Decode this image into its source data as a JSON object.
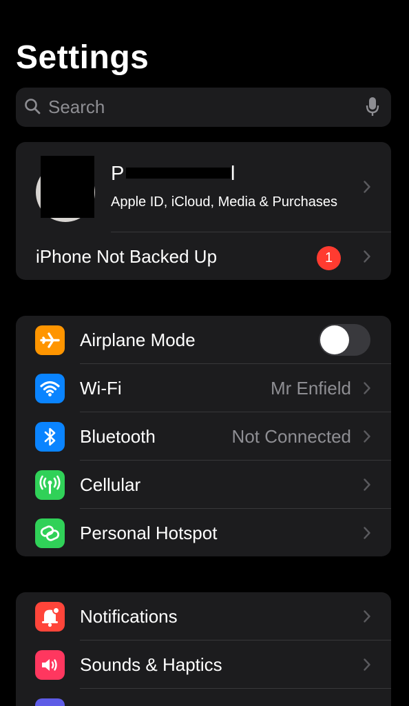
{
  "header": {
    "title": "Settings"
  },
  "search": {
    "placeholder": "Search"
  },
  "profile": {
    "name_prefix": "P",
    "name_suffix": "l",
    "subtitle": "Apple ID, iCloud, Media & Purchases",
    "backup_label": "iPhone Not Backed Up",
    "backup_badge": "1"
  },
  "connectivity": {
    "airplane": {
      "label": "Airplane Mode",
      "toggle_on": false,
      "icon": "airplane-icon",
      "color": "#ff9500"
    },
    "wifi": {
      "label": "Wi-Fi",
      "value": "Mr Enfield",
      "icon": "wifi-icon",
      "color": "#0a84ff"
    },
    "bluetooth": {
      "label": "Bluetooth",
      "value": "Not Connected",
      "icon": "bluetooth-icon",
      "color": "#0a84ff"
    },
    "cellular": {
      "label": "Cellular",
      "icon": "cellular-antenna-icon",
      "color": "#30d158"
    },
    "hotspot": {
      "label": "Personal Hotspot",
      "icon": "hotspot-link-icon",
      "color": "#30d158"
    }
  },
  "notifications_group": {
    "notifications": {
      "label": "Notifications",
      "icon": "notification-bell-icon",
      "color": "#ff453a"
    },
    "sounds": {
      "label": "Sounds & Haptics",
      "icon": "speaker-icon",
      "color": "#ff375f"
    }
  },
  "colors": {
    "background": "#000000",
    "cell": "#1c1c1e",
    "secondary_text": "#8e8e93",
    "separator": "#38383a",
    "badge": "#ff3b30",
    "focus_purple": "#5e5ce6"
  }
}
